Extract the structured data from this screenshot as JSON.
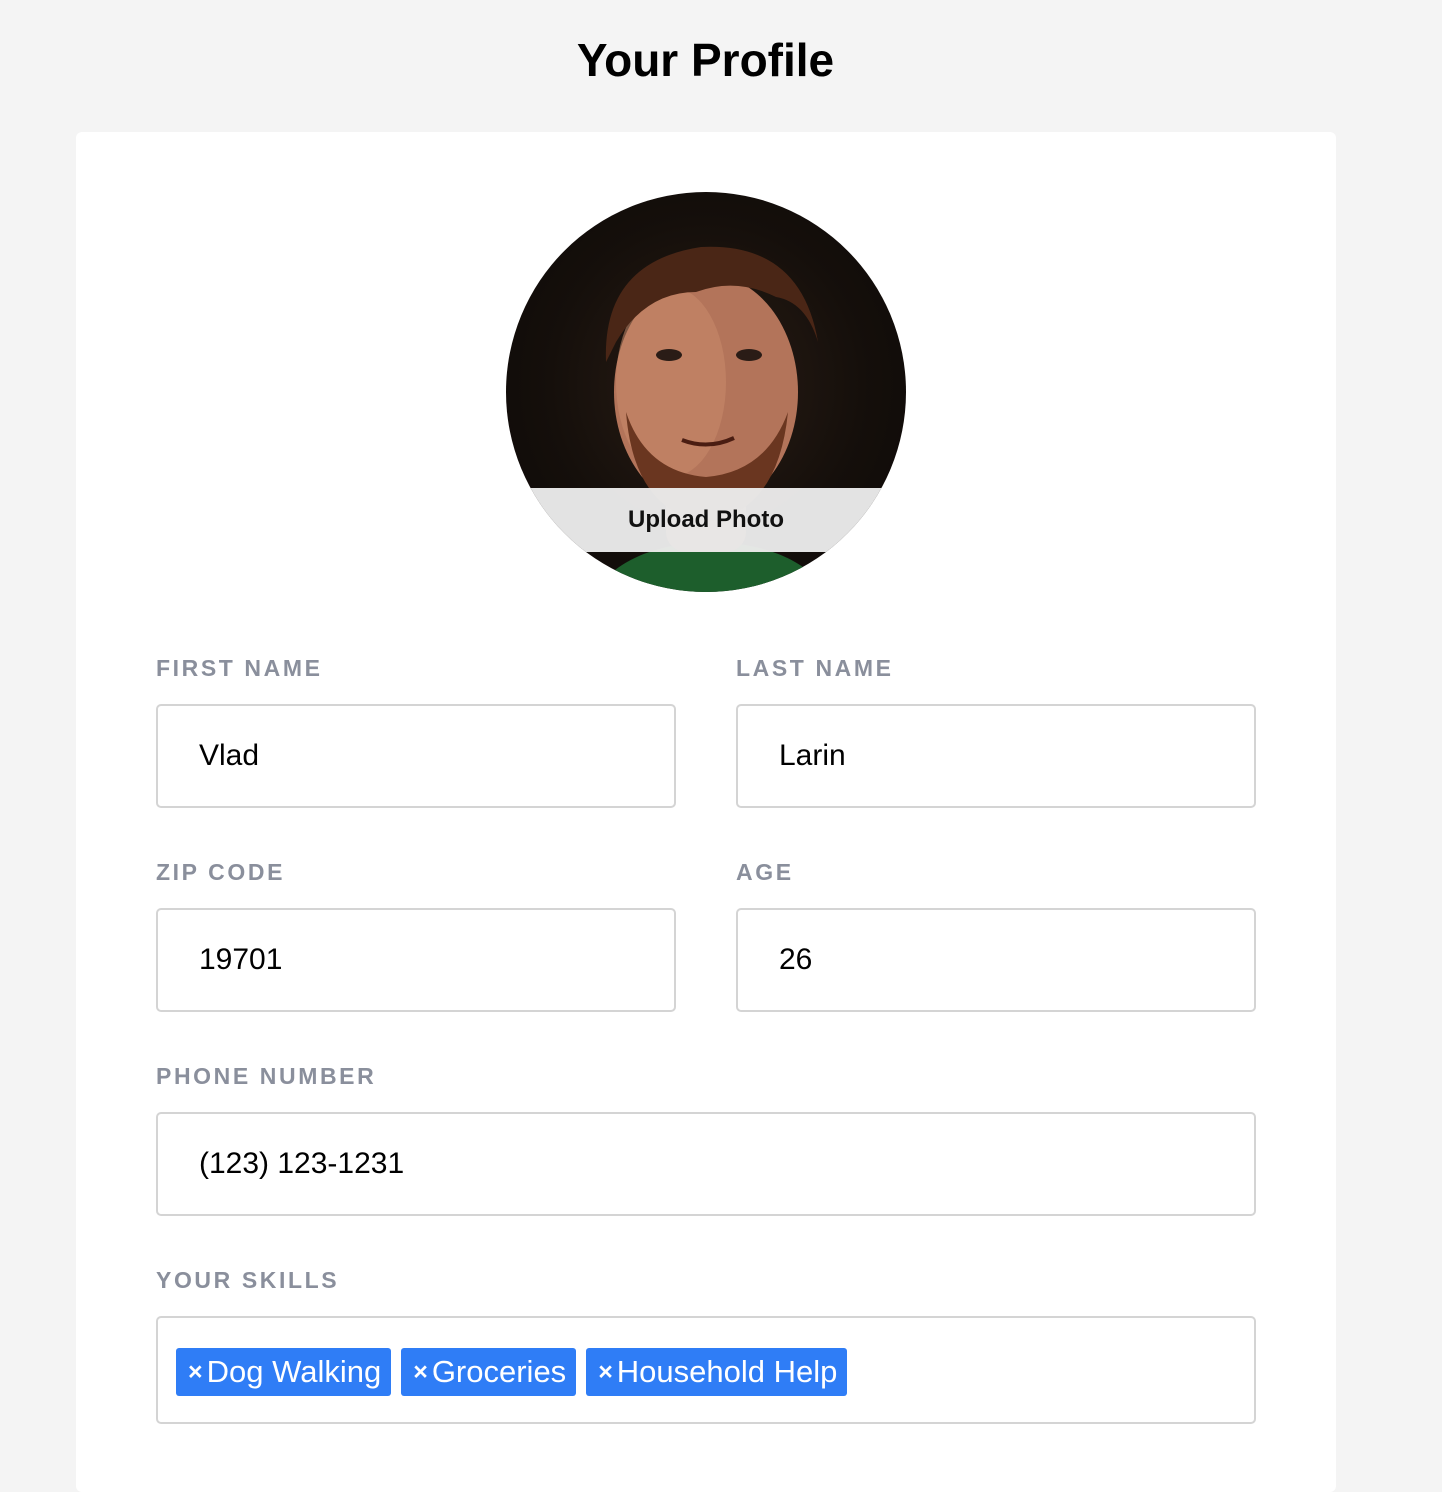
{
  "page": {
    "title": "Your Profile"
  },
  "avatar": {
    "upload_label": "Upload Photo"
  },
  "form": {
    "first_name": {
      "label": "FIRST NAME",
      "value": "Vlad"
    },
    "last_name": {
      "label": "LAST NAME",
      "value": "Larin"
    },
    "zip_code": {
      "label": "ZIP CODE",
      "value": "19701"
    },
    "age": {
      "label": "AGE",
      "value": "26"
    },
    "phone": {
      "label": "PHONE NUMBER",
      "value": "(123) 123-1231"
    },
    "skills": {
      "label": "YOUR SKILLS",
      "remove_glyph": "×",
      "items": [
        "Dog Walking",
        "Groceries",
        "Household Help"
      ]
    }
  },
  "colors": {
    "page_background": "#f4f4f4",
    "card_background": "#ffffff",
    "label_text": "#8a8f9c",
    "input_border": "#d4d4d4",
    "skill_tag": "#2f7df6"
  }
}
